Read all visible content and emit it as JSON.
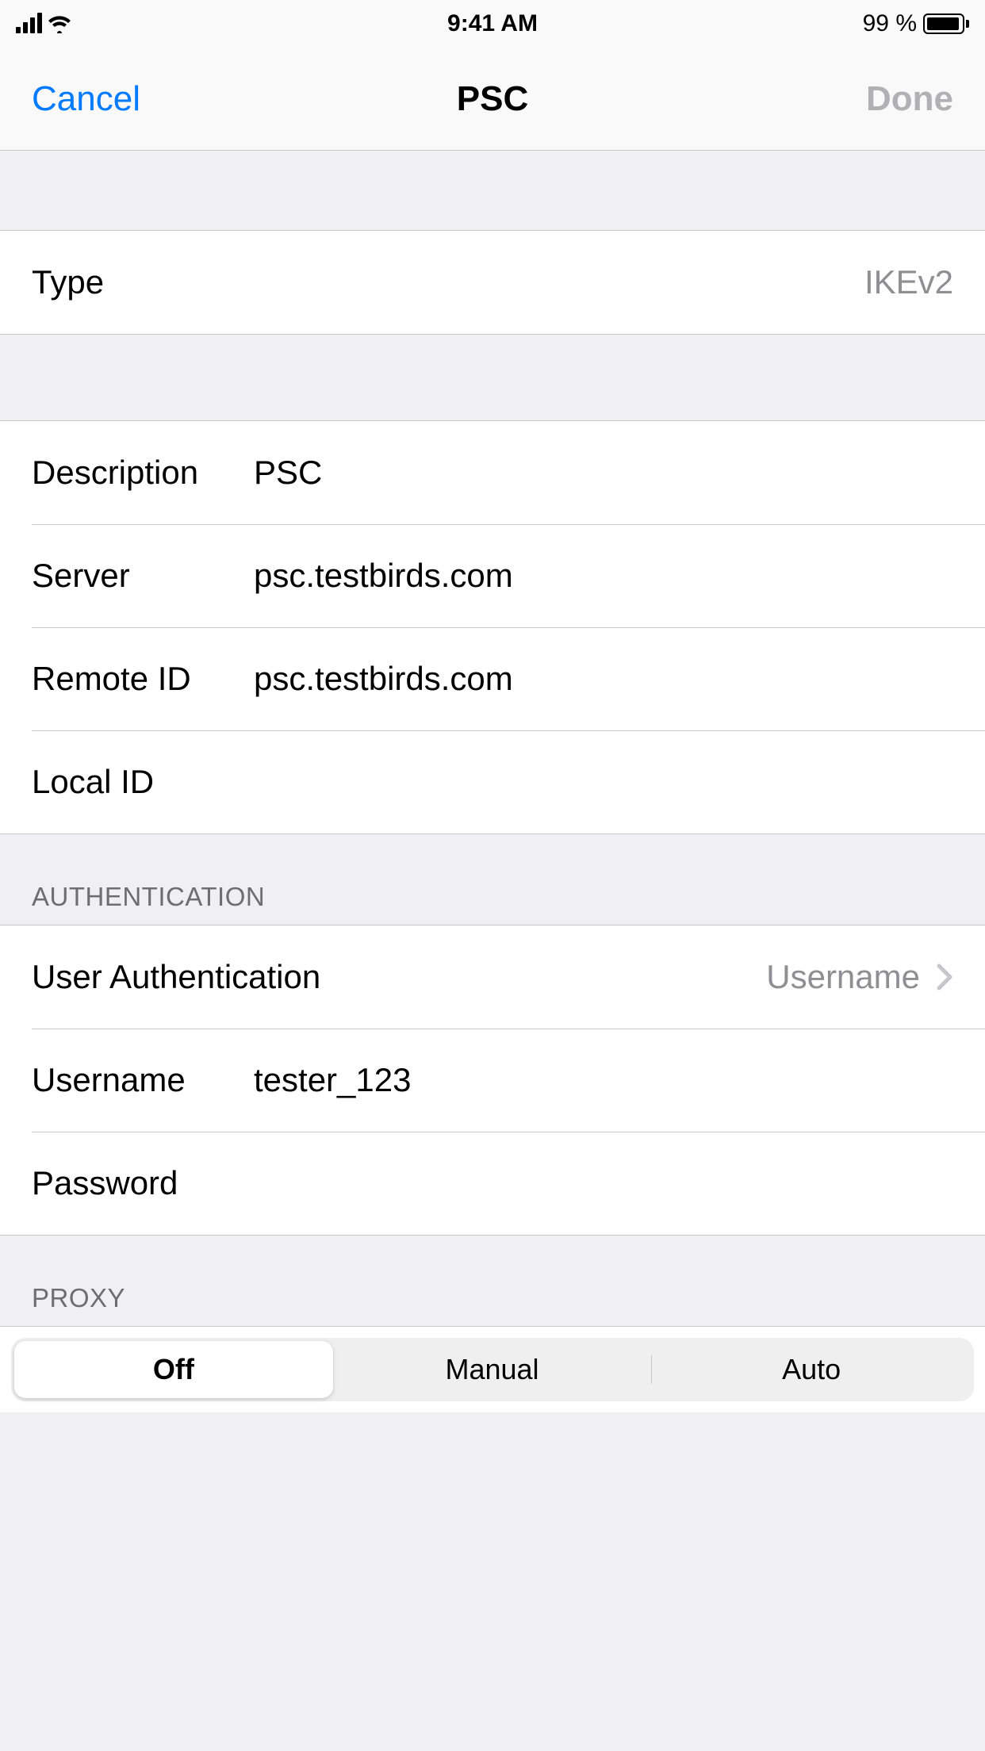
{
  "status": {
    "time": "9:41 AM",
    "battery_pct": "99 %"
  },
  "nav": {
    "cancel": "Cancel",
    "title": "PSC",
    "done": "Done"
  },
  "type_row": {
    "label": "Type",
    "value": "IKEv2"
  },
  "config": {
    "description_label": "Description",
    "description_value": "PSC",
    "server_label": "Server",
    "server_value": "psc.testbirds.com",
    "remote_id_label": "Remote ID",
    "remote_id_value": "psc.testbirds.com",
    "local_id_label": "Local ID",
    "local_id_value": ""
  },
  "auth": {
    "header": "AUTHENTICATION",
    "user_auth_label": "User Authentication",
    "user_auth_value": "Username",
    "username_label": "Username",
    "username_value": "tester_123",
    "password_label": "Password",
    "password_value": ""
  },
  "proxy": {
    "header": "PROXY",
    "off": "Off",
    "manual": "Manual",
    "auto": "Auto"
  }
}
